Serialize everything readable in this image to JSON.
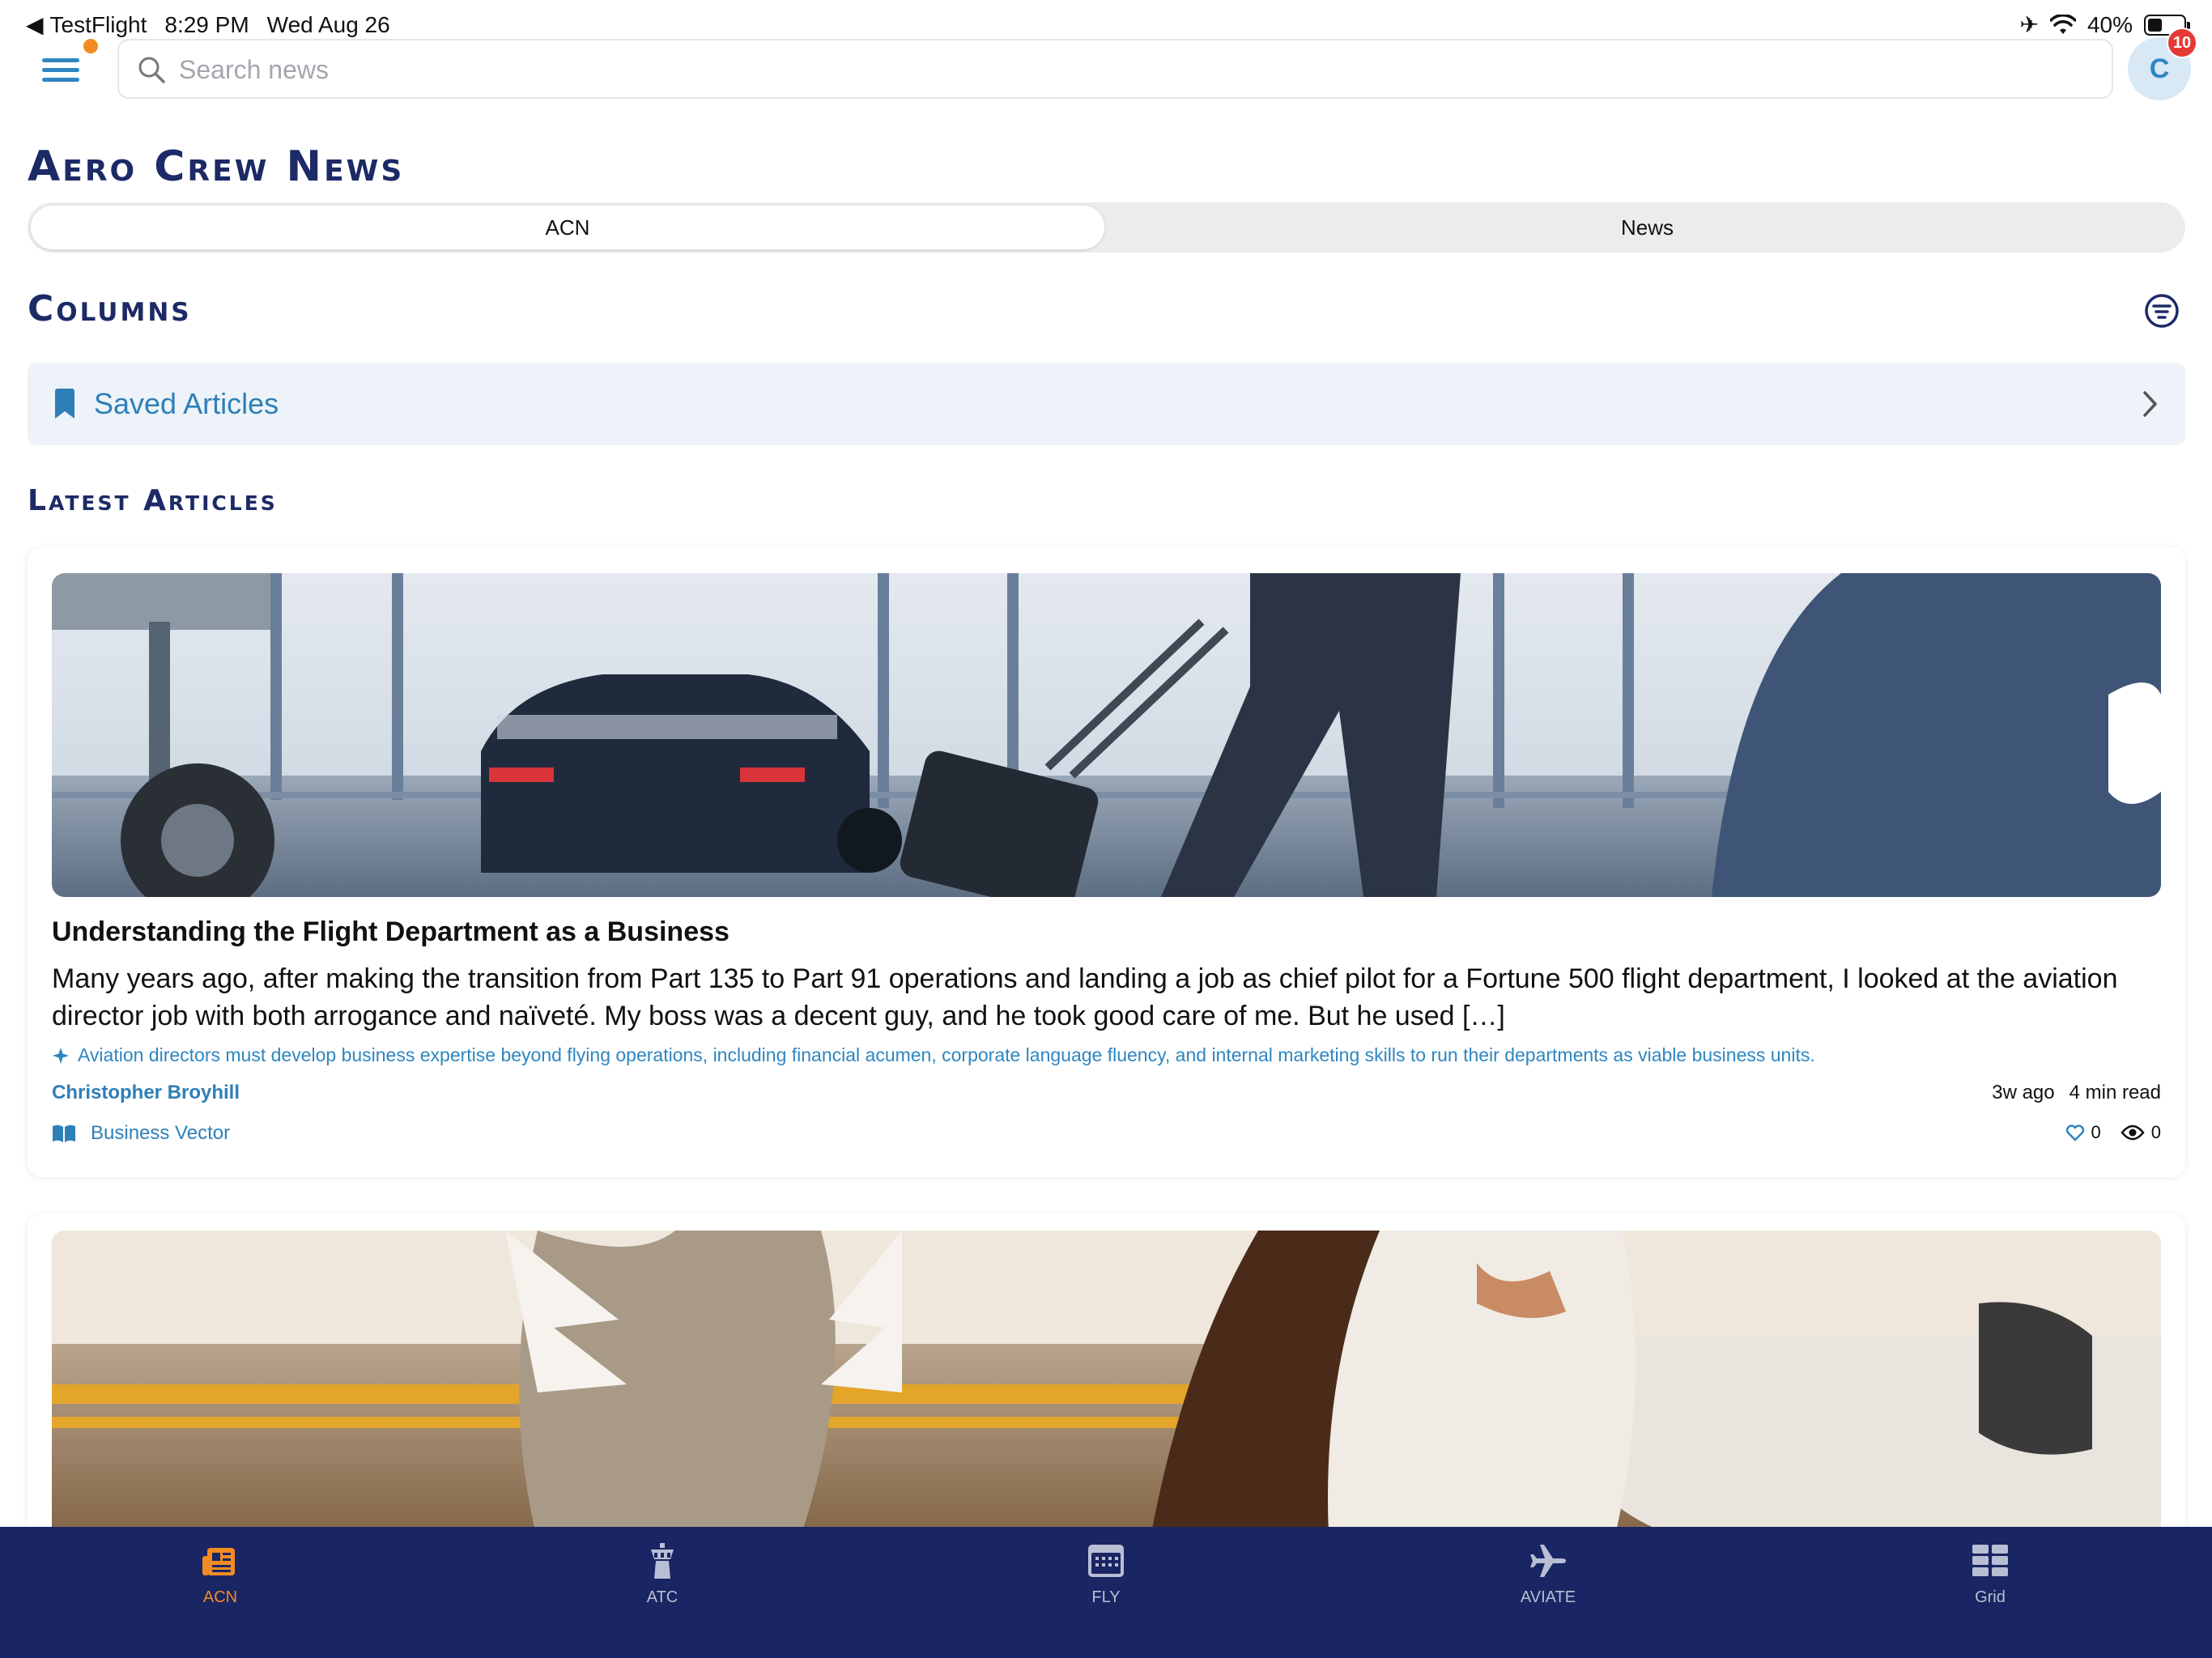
{
  "status_bar": {
    "back_app": "TestFlight",
    "time": "8:29 PM",
    "date": "Wed Aug 26",
    "battery": "40%"
  },
  "header": {
    "search_placeholder": "Search news",
    "avatar_initial": "C",
    "notification_count": "10"
  },
  "page_title": "Aero Crew News",
  "segments": [
    {
      "label": "ACN",
      "selected": true
    },
    {
      "label": "News",
      "selected": false
    }
  ],
  "columns": {
    "title": "Columns",
    "saved_label": "Saved Articles"
  },
  "latest": {
    "title": "Latest Articles",
    "articles": [
      {
        "title": "Understanding the Flight Department as a Business",
        "excerpt": "Many years ago, after making the transition from Part 135 to Part 91 operations and landing a job as chief pilot for a Fortune 500 flight department, I looked at the aviation director job with both arrogance and naïveté. My boss was a decent guy, and he took good care of me. But he used […]",
        "summary": "Aviation directors must develop business expertise beyond flying operations, including financial acumen, corporate language fluency, and internal marketing skills to run their departments as viable business units.",
        "author": "Christopher Broyhill",
        "age": "3w ago",
        "read_time": "4 min read",
        "category": "Business Vector",
        "likes": "0",
        "views": "0"
      }
    ]
  },
  "tabbar": [
    {
      "label": "ACN",
      "icon": "newspaper-icon",
      "active": true
    },
    {
      "label": "ATC",
      "icon": "control-tower-icon",
      "active": false
    },
    {
      "label": "FLY",
      "icon": "calendar-icon",
      "active": false
    },
    {
      "label": "AVIATE",
      "icon": "airplane-icon",
      "active": false
    },
    {
      "label": "Grid",
      "icon": "grid-icon",
      "active": false
    }
  ],
  "colors": {
    "navy": "#1a2563",
    "heading": "#1c2a66",
    "accent_blue": "#2e86c1",
    "accent_orange": "#f28c22",
    "badge_red": "#e53935"
  }
}
